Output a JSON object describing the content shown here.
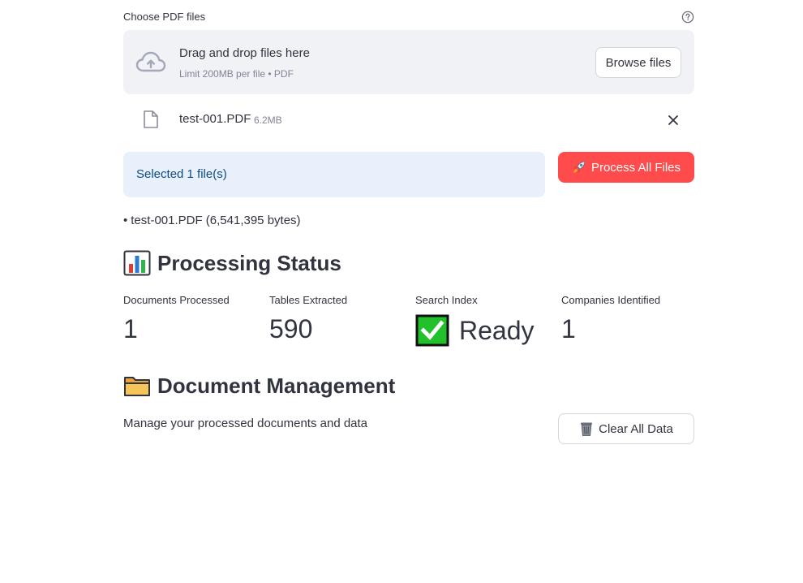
{
  "uploader": {
    "label": "Choose PDF files",
    "help_icon": "help-circle-icon",
    "dropzone_title": "Drag and drop files here",
    "dropzone_subtitle": "Limit 200MB per file • PDF",
    "browse_label": "Browse files"
  },
  "uploaded_file": {
    "name": "test-001.PDF",
    "size": "6.2MB"
  },
  "selection": {
    "info_text": "Selected 1 file(s)",
    "process_label": "Process All Files",
    "process_icon": "rocket-icon",
    "files": [
      "test-001.PDF (6,541,395 bytes)"
    ]
  },
  "status_section": {
    "title": "Processing Status",
    "icon": "bar-chart-icon",
    "metrics": [
      {
        "label": "Documents Processed",
        "value": "1"
      },
      {
        "label": "Tables Extracted",
        "value": "590"
      },
      {
        "label": "Search Index",
        "value": "Ready",
        "icon": "check-mark-icon"
      },
      {
        "label": "Companies Identified",
        "value": "1"
      }
    ]
  },
  "doc_section": {
    "title": "Document Management",
    "icon": "folder-icon",
    "description": "Manage your processed documents and data",
    "clear_label": "Clear All Data",
    "clear_icon": "wastebasket-icon"
  },
  "colors": {
    "primary": "#ff4b4b",
    "info_bg": "#e8f1fb",
    "info_text": "#0f4a85",
    "dropzone_bg": "#f0f2f6",
    "check_green": "#22c02a"
  }
}
